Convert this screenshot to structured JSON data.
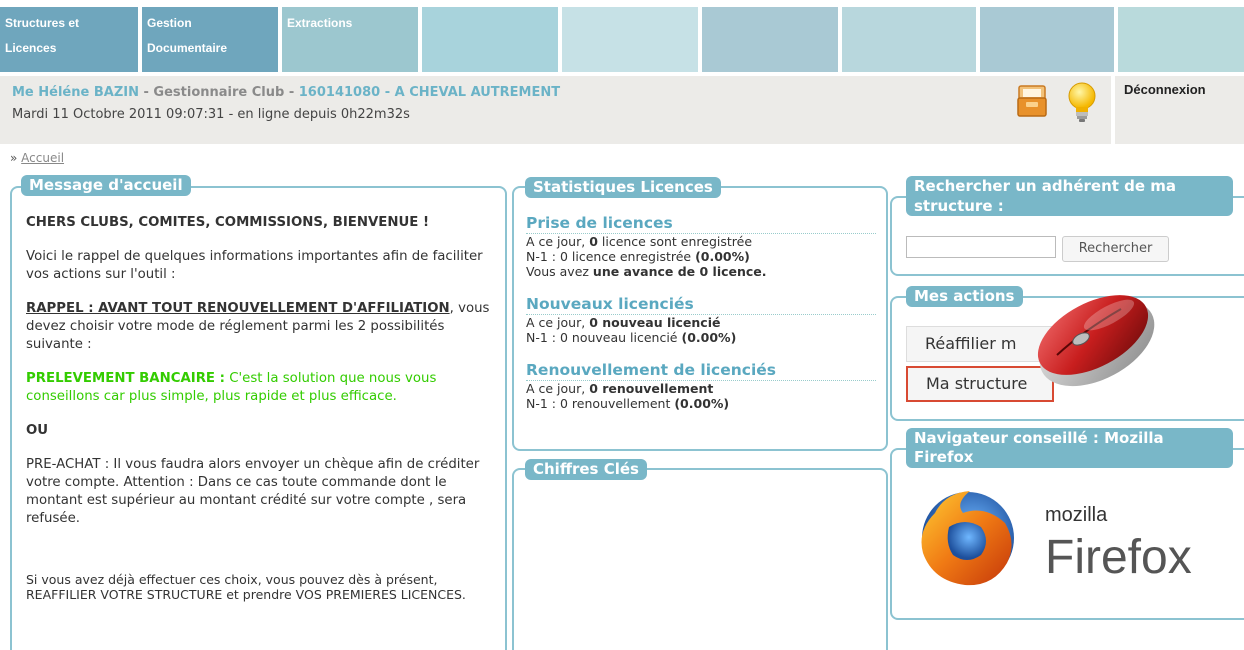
{
  "nav": {
    "tiles": [
      {
        "label": "Structures et Licences",
        "color": "#6fa6bd"
      },
      {
        "label": "Gestion Documentaire",
        "color": "#6fa6bd"
      },
      {
        "label": "Extractions",
        "color": "#9cc7cf"
      },
      {
        "label": "",
        "color": "#a8d3dc"
      },
      {
        "label": "",
        "color": "#c6e1e6"
      },
      {
        "label": "",
        "color": "#a9c9d4"
      },
      {
        "label": "",
        "color": "#b8d7dd"
      },
      {
        "label": "",
        "color": "#a9c9d4"
      },
      {
        "label": "",
        "color": "#b9dadc"
      }
    ]
  },
  "header": {
    "user_name": "Me Héléne BAZIN",
    "role": "Gestionnaire Club",
    "club_id": "160141080",
    "club_name": "A CHEVAL AUTREMENT",
    "datetime": "Mardi 11 Octobre 2011 09:07:31 - en ligne depuis 0h22m32s",
    "logout": "Déconnexion",
    "sep1": " - ",
    "sep2": " - ",
    "sep3": " - "
  },
  "breadcrumb": {
    "prefix": "»",
    "link": "Accueil"
  },
  "welcome": {
    "title": "Message d'accueil",
    "greeting": "CHERS CLUBS, COMITES, COMMISSIONS, BIENVENUE !",
    "intro": "Voici le rappel de quelques informations importantes afin de faciliter vos actions sur l'outil :",
    "rappel_bold": "RAPPEL : AVANT TOUT RENOUVELLEMENT D'AFFILIATION",
    "rappel_rest": ", vous devez choisir votre mode de réglement parmi les 2 possibilités suivante :",
    "prelev_bold": "PRELEVEMENT BANCAIRE :",
    "prelev_rest": " C'est la solution que nous vous conseillons car plus simple, plus rapide et plus efficace.",
    "ou": "OU",
    "preachat": "PRE-ACHAT : Il vous faudra alors envoyer un chèque afin de créditer votre compte. Attention : Dans ce cas toute commande dont le montant est supérieur au montant crédité sur votre compte , sera refusée.",
    "closing": "Si vous avez déjà effectuer ces choix, vous pouvez dès à présent, REAFFILIER VOTRE STRUCTURE et prendre VOS PREMIERES LICENCES."
  },
  "stats": {
    "title": "Statistiques Licences",
    "sections": [
      {
        "heading": "Prise de licences",
        "l1_pre": "A ce jour, ",
        "l1_bold": "0",
        "l1_post": " licence sont enregistrée",
        "l2_pre": "N-1 : 0 licence enregistrée ",
        "l2_bold": "(0.00%)",
        "l3_pre": "Vous avez ",
        "l3_bold": "une avance de 0 licence."
      },
      {
        "heading": "Nouveaux licenciés",
        "l1_pre": "A ce jour, ",
        "l1_bold": "0 nouveau licencié",
        "l2_pre": "N-1 : 0 nouveau licencié ",
        "l2_bold": "(0.00%)"
      },
      {
        "heading": "Renouvellement de licenciés",
        "l1_pre": "A ce jour, ",
        "l1_bold": "0 renouvellement",
        "l2_pre": "N-1 : 0 renouvellement ",
        "l2_bold": "(0.00%)"
      }
    ]
  },
  "chiffres": {
    "title": "Chiffres Clés"
  },
  "search": {
    "title": "Rechercher un adhérent de ma structure :",
    "input_value": "",
    "button": "Rechercher"
  },
  "actions": {
    "title": "Mes actions",
    "reaffilier": "Réaffilier m",
    "structure": "Ma structure"
  },
  "browser": {
    "title": "Navigateur conseillé : Mozilla Firefox",
    "logo_small": "mozilla",
    "logo_big": "Firefox"
  }
}
